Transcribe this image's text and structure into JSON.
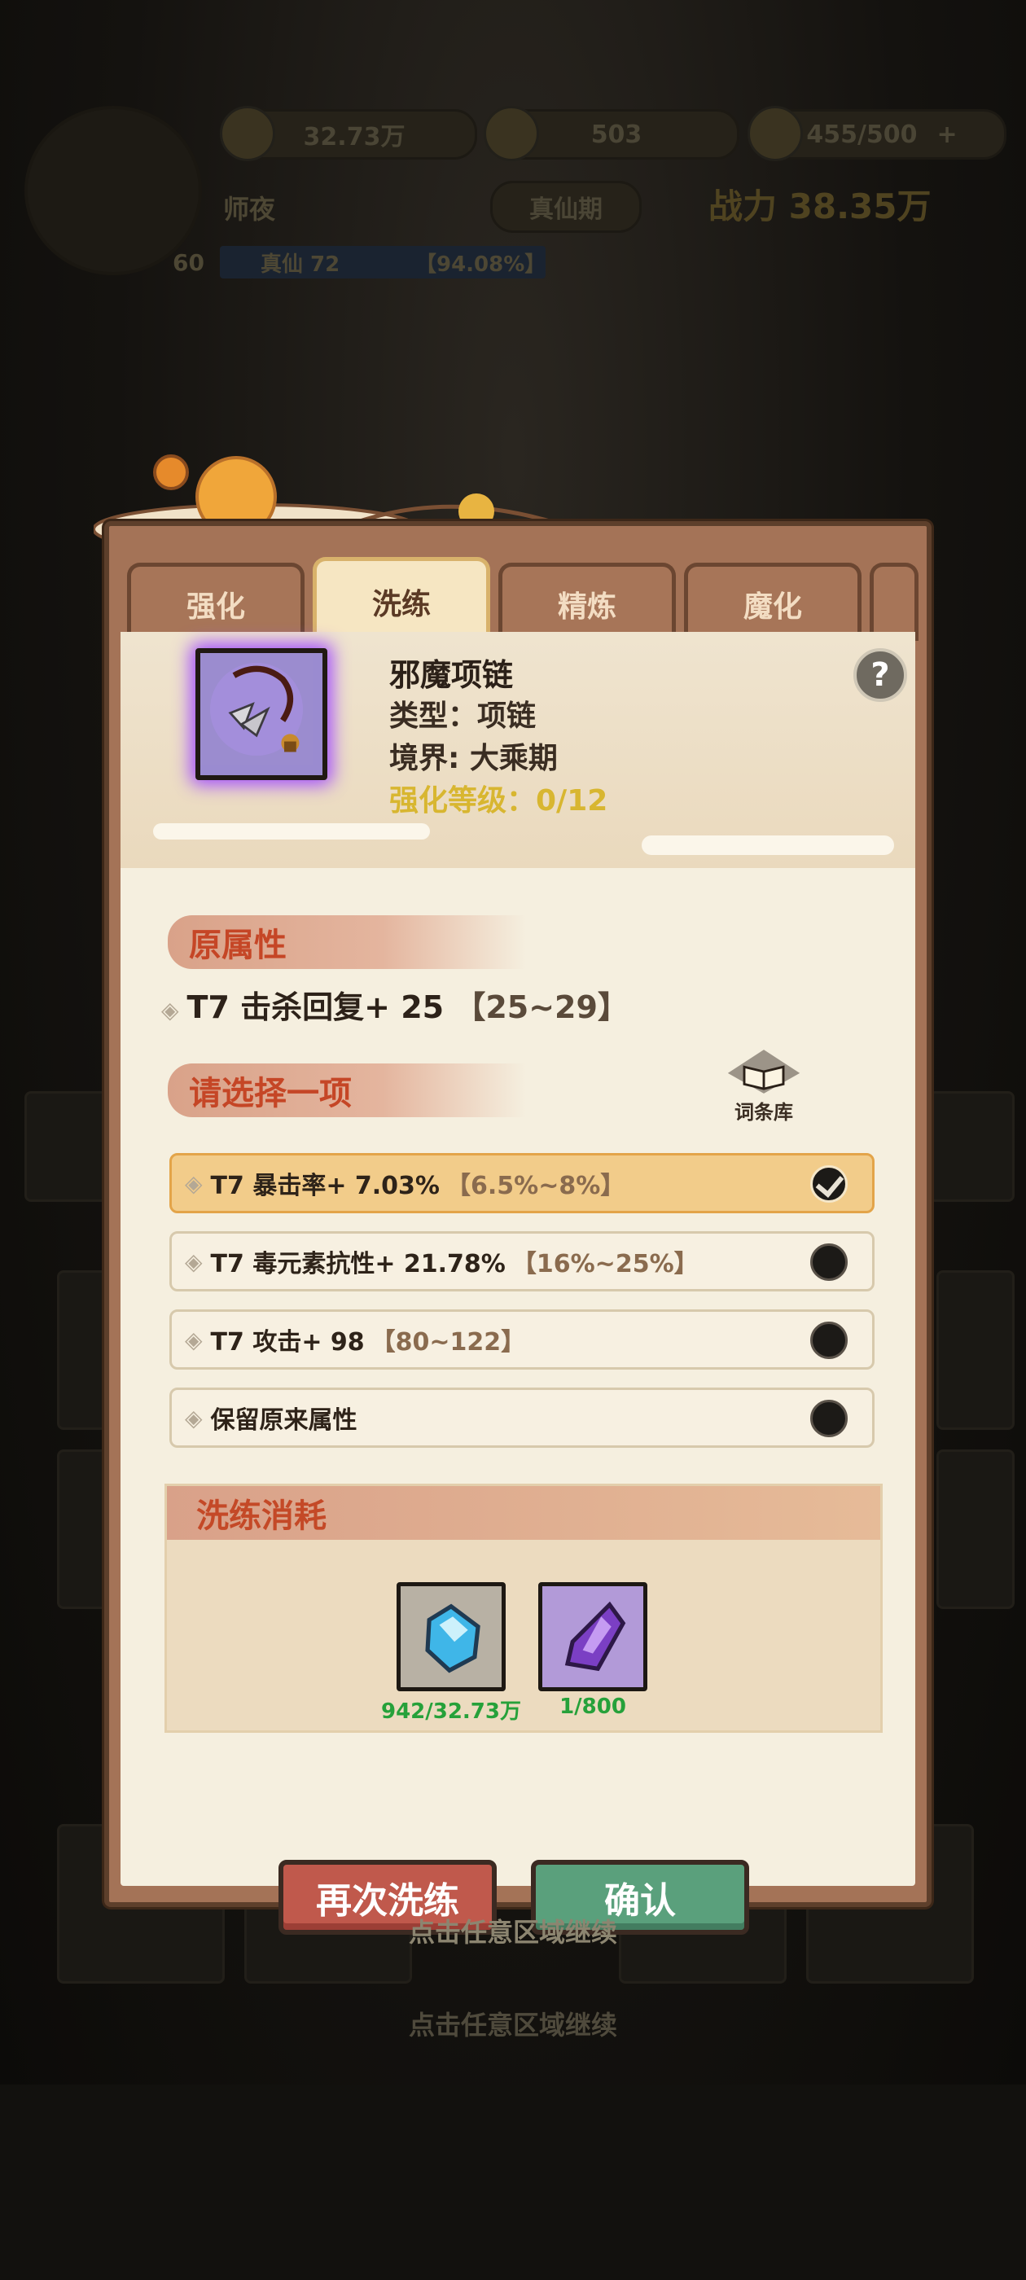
{
  "hud": {
    "spirit_stones": "32.73万",
    "gold": "503",
    "stamina": "455/500",
    "plus": "+",
    "player_name": "师夜",
    "realm_badge": "真仙期",
    "power": "战力 38.35万",
    "level": "60",
    "exp_label": "真仙 72",
    "exp_percent": "【94.08%】"
  },
  "tabs": [
    "强化",
    "洗练",
    "精炼",
    "魔化"
  ],
  "active_tab": "洗练",
  "item": {
    "name": "邪魔项链",
    "type": "类型：项链",
    "realm": "境界: 大乘期",
    "enhance": "强化等级：0/12"
  },
  "original": {
    "title": "原属性",
    "stat": "T7 击杀回复+ 25",
    "range": "【25~29】"
  },
  "choose": {
    "title": "请选择一项",
    "library_label": "词条库",
    "options": [
      {
        "text": "T7 暴击率+ 7.03%",
        "range": "【6.5%~8%】",
        "selected": true
      },
      {
        "text": "T7 毒元素抗性+ 21.78%",
        "range": "【16%~25%】",
        "selected": false
      },
      {
        "text": "T7 攻击+ 98",
        "range": "【80~122】",
        "selected": false
      },
      {
        "text": "保留原来属性",
        "range": "",
        "selected": false
      }
    ]
  },
  "cost": {
    "title": "洗练消耗",
    "items": [
      {
        "icon": "blue-crystal-icon",
        "count": "942/32.73万"
      },
      {
        "icon": "purple-crystal-icon",
        "count": "1/800"
      }
    ]
  },
  "buttons": {
    "retry": "再次洗练",
    "confirm": "确认"
  },
  "continue_text": "点击任意区域继续",
  "colors": {
    "accent_red": "#c54626",
    "selected_option": "#f2cc8a",
    "cost_green": "#26a13a",
    "gold_text": "#d8b630"
  }
}
